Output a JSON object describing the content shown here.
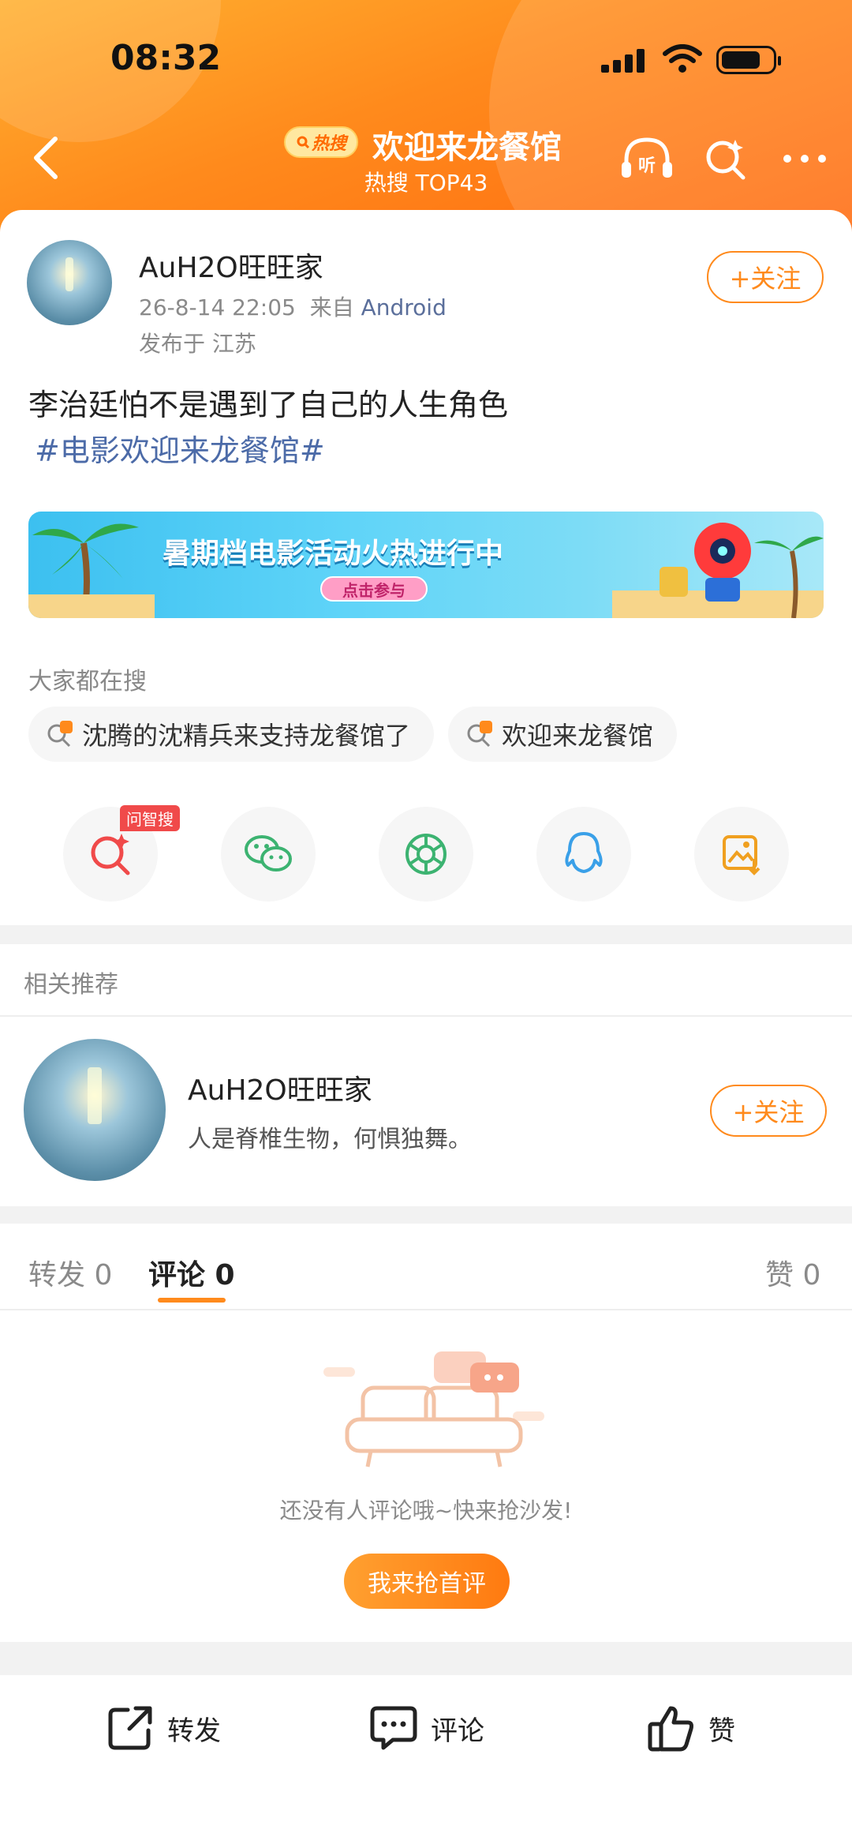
{
  "status_bar": {
    "time": "08:32"
  },
  "nav": {
    "hot_badge": "热搜",
    "title": "欢迎来龙餐馆",
    "subtitle": "热搜 TOP43",
    "listen_label": "听"
  },
  "post": {
    "author": "AuH2O旺旺家",
    "datetime": "26-8-14 22:05",
    "source_prefix": "来自",
    "source": "Android",
    "location": "发布于 江苏",
    "follow_label": "+关注",
    "text": "李治廷怕不是遇到了自己的人生角色",
    "hashtag": "#电影欢迎来龙餐馆#"
  },
  "banner": {
    "title": "暑期档电影活动火热进行中",
    "cta": "点击参与"
  },
  "searching": {
    "label": "大家都在搜",
    "chips": [
      "沈腾的沈精兵来支持龙餐馆了",
      "欢迎来龙餐馆"
    ]
  },
  "share": {
    "ask_tag": "问智搜"
  },
  "related": {
    "label": "相关推荐",
    "name": "AuH2O旺旺家",
    "bio": "人是脊椎生物，何惧独舞。",
    "follow_label": "+关注"
  },
  "tabs": {
    "repost": "转发 0",
    "comment": "评论 0",
    "like": "赞 0"
  },
  "empty": {
    "text": "还没有人评论哦~快来抢沙发!",
    "button": "我来抢首评"
  },
  "bottom": {
    "repost": "转发",
    "comment": "评论",
    "like": "赞"
  },
  "colors": {
    "accent": "#ff8a1c",
    "link": "#4c6ba8",
    "hot_red": "#f04a4a"
  }
}
